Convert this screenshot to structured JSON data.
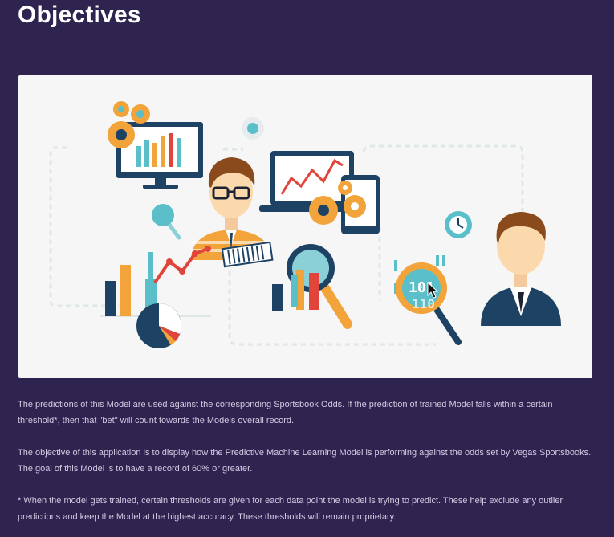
{
  "page": {
    "title": "Objectives"
  },
  "hero": {
    "illustration": "machine-learning-analytics-illustration",
    "colors": {
      "background": "#f6f6f6",
      "navy": "#1d4263",
      "teal": "#5bbfc9",
      "orange": "#f2a33a",
      "red": "#e0443a"
    }
  },
  "paragraphs": [
    "The predictions of this Model are used against the corresponding Sportsbook Odds. If the prediction of trained Model falls within a certain threshold*, then that \"bet\" will count towards the Models overall record.",
    "The objective of this application is to display how the Predictive Machine Learning Model is performing against the odds set by Vegas Sportsbooks. The goal of this Model is to have a record of 60% or greater.",
    "* When the model gets trained, certain thresholds are given for each data point the model is trying to predict. These help exclude any outlier predictions and keep the Model at the highest accuracy. These thresholds will remain proprietary."
  ],
  "theme": {
    "background": "#2f2350",
    "divider": "#b066a8",
    "text": "#d2cbe2"
  }
}
